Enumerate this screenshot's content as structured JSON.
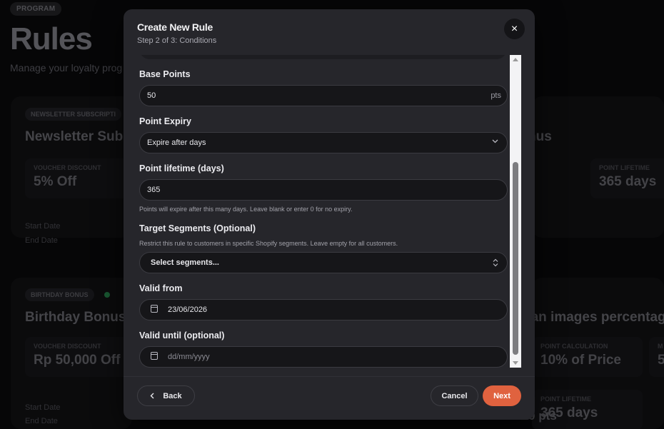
{
  "background": {
    "program_badge": "PROGRAM",
    "title": "Rules",
    "subtitle": "Manage your loyalty prog",
    "newsletter": {
      "badge": "NEWSLETTER SUBSCRIPTI",
      "title": "Newsletter Subs",
      "stat_label": "VOUCHER DISCOUNT",
      "stat_value": "5% Off",
      "start_label": "Start Date",
      "end_label": "End Date"
    },
    "right_top": {
      "title_fragment": "nus",
      "stat_label": "POINT LIFETIME",
      "stat_value": "365 days"
    },
    "birthday": {
      "badge": "BIRTHDAY BONUS",
      "title": "Birthday Bonus V",
      "stat_label": "VOUCHER DISCOUNT",
      "stat_value": "Rp 50,000 Off",
      "start_label": "Start Date",
      "end_label": "End Date"
    },
    "right_bottom": {
      "title_fragment": "gan images percentage",
      "stat1_label": "POINT CALCULATION",
      "stat1_value": "10% of Price",
      "stat2_label": "POINT LIFETIME",
      "stat2_value": "365 days",
      "points_fragment": "-20 pts",
      "edge_label": "M",
      "edge_value": "5"
    }
  },
  "modal": {
    "title": "Create New Rule",
    "step": "Step 2 of 3: Conditions",
    "close_icon": "×",
    "fields": {
      "base_points_label": "Base Points",
      "base_points_value": "50",
      "base_points_suffix": "pts",
      "expiry_label": "Point Expiry",
      "expiry_value": "Expire after days",
      "lifetime_label": "Point lifetime (days)",
      "lifetime_value": "365",
      "lifetime_help": "Points will expire after this many days. Leave blank or enter 0 for no expiry.",
      "segments_label": "Target Segments (Optional)",
      "segments_help": "Restrict this rule to customers in specific Shopify segments. Leave empty for all customers.",
      "segments_placeholder": "Select segments...",
      "valid_from_label": "Valid from",
      "valid_from_value": "23/06/2026",
      "valid_until_label": "Valid until (optional)",
      "valid_until_placeholder": "dd/mm/yyyy"
    },
    "buttons": {
      "back": "Back",
      "cancel": "Cancel",
      "next": "Next"
    }
  },
  "colors": {
    "accent": "#e0623f",
    "status_active": "#2f9e5a"
  }
}
